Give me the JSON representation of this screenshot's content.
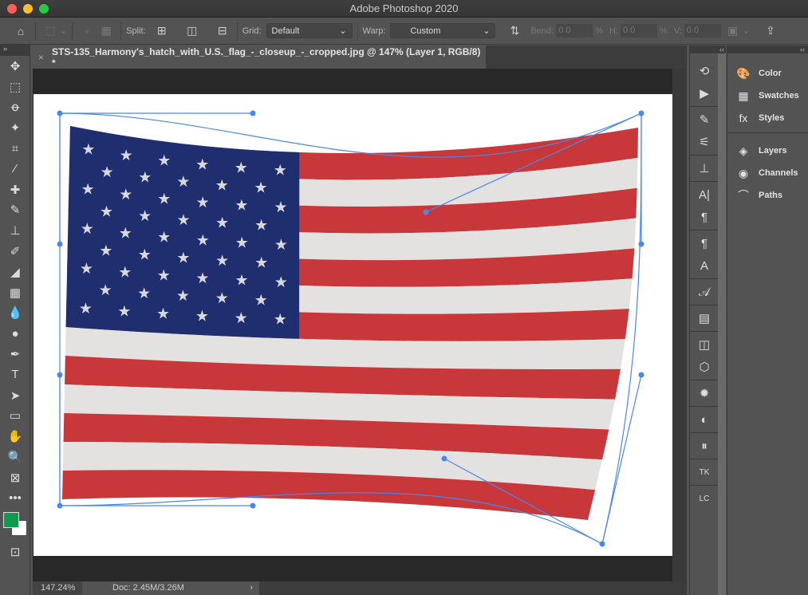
{
  "window": {
    "title": "Adobe Photoshop 2020"
  },
  "options": {
    "split_label": "Split:",
    "grid_label": "Grid:",
    "grid_value": "Default",
    "warp_label": "Warp:",
    "warp_value": "Custom",
    "bend_label": "Bend:",
    "bend_value": "0.0",
    "h_label": "H:",
    "h_value": "0.0",
    "v_label": "V:",
    "v_value": "0.0",
    "percent": "%"
  },
  "document": {
    "tab_title": "STS-135_Harmony's_hatch_with_U.S._flag_-_closeup_-_cropped.jpg @ 147% (Layer 1, RGB/8) *",
    "close": "×"
  },
  "status": {
    "zoom": "147.24%",
    "doc": "Doc: 2.45M/3.26M",
    "arrow": "›"
  },
  "colors": {
    "foreground": "#0f9a4f",
    "background": "#ffffff",
    "warp_handle": "#4a87e8",
    "flag_red": "#c8383a",
    "flag_blue": "#1f2e6e"
  },
  "tools": [
    "move",
    "marquee",
    "lasso",
    "magic-wand",
    "crop",
    "eyedropper",
    "healing",
    "brush",
    "stamp",
    "history-brush",
    "eraser",
    "gradient",
    "blur",
    "dodge",
    "pen",
    "type",
    "path-select",
    "rectangle",
    "hand",
    "zoom",
    "frame",
    "more"
  ],
  "tool_glyphs": [
    "✥",
    "⬚",
    "ꝋ",
    "✦",
    "⌗",
    "⁄",
    "✚",
    "✎",
    "⊥",
    "✐",
    "◢",
    "▦",
    "💧",
    "●",
    "✒",
    "T",
    "➤",
    "▭",
    "✋",
    "🔍",
    "⊠",
    "•••"
  ],
  "right_icons": [
    {
      "name": "history",
      "g": "⟲"
    },
    {
      "name": "actions",
      "g": "▶"
    },
    {
      "name": "brush-settings",
      "g": "✎"
    },
    {
      "name": "tool-presets",
      "g": "⚟"
    },
    {
      "name": "clone-source",
      "g": "⊥"
    },
    {
      "name": "character",
      "g": "A|"
    },
    {
      "name": "paragraph",
      "g": "¶"
    },
    {
      "name": "paragraph-styles",
      "g": "¶"
    },
    {
      "name": "character-styles",
      "g": "A"
    },
    {
      "name": "glyphs",
      "g": "𝒜"
    },
    {
      "name": "notes",
      "g": "▤"
    },
    {
      "name": "3d",
      "g": "◫"
    },
    {
      "name": "3d-cube",
      "g": "⬡"
    },
    {
      "name": "plugin",
      "g": "✹"
    },
    {
      "name": "adjustments",
      "g": "◐"
    },
    {
      "name": "properties",
      "g": "⏸"
    },
    {
      "name": "tk",
      "g": "TK"
    },
    {
      "name": "layer-cake",
      "g": "LC"
    }
  ],
  "panels": [
    {
      "label": "Color",
      "icon": "palette",
      "g": "🎨"
    },
    {
      "label": "Swatches",
      "icon": "grid",
      "g": "▦"
    },
    {
      "label": "Styles",
      "icon": "fx",
      "g": "fx"
    },
    {
      "label": "Layers",
      "icon": "layers",
      "g": "◈"
    },
    {
      "label": "Channels",
      "icon": "channels",
      "g": "◉"
    },
    {
      "label": "Paths",
      "icon": "paths",
      "g": "⌒"
    }
  ]
}
